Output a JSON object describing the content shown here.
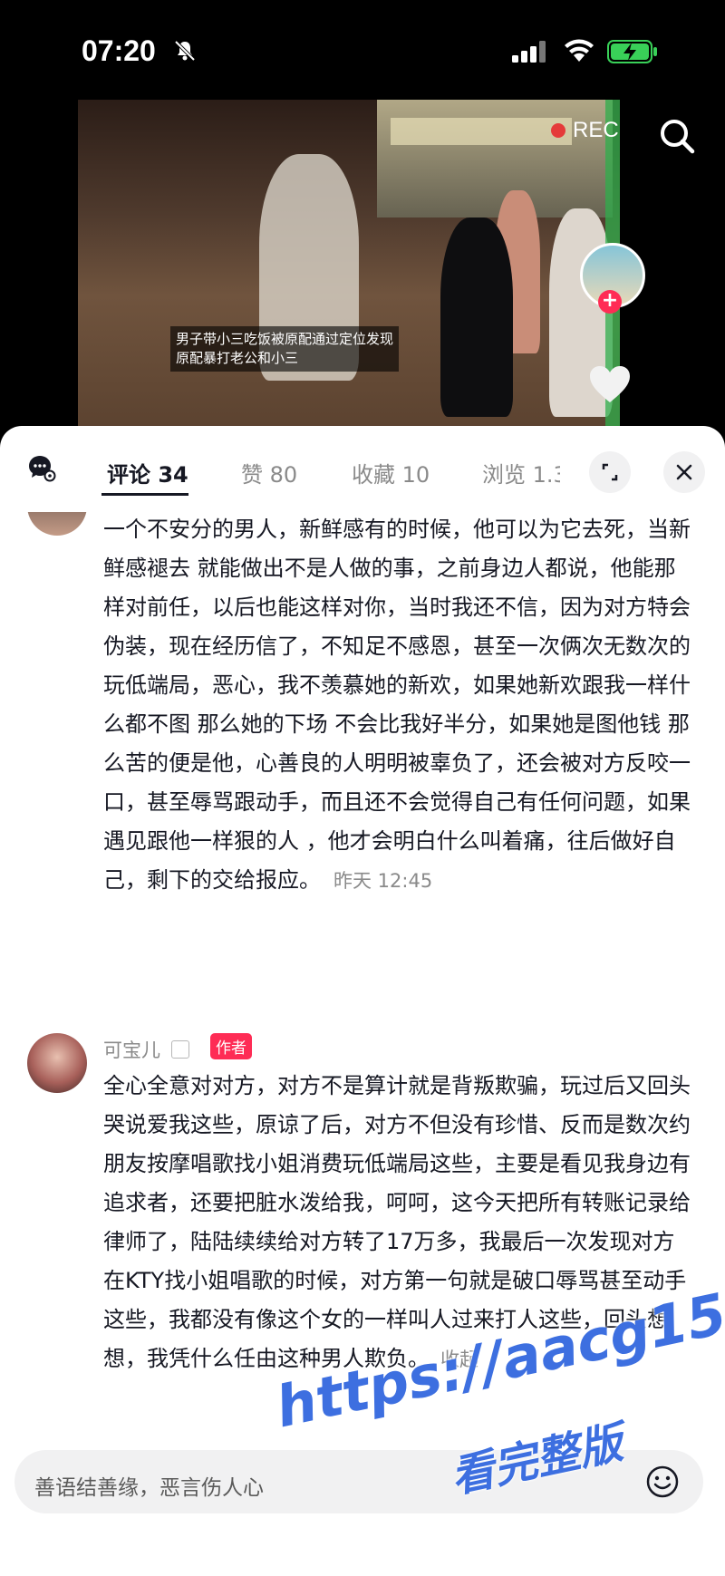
{
  "status_bar": {
    "time": "07:20"
  },
  "video": {
    "caption": "男子带小三吃饭被原配通过定位发现\n原配暴打老公和小三",
    "rec_label": "REC"
  },
  "tabs": [
    {
      "label": "评论 34",
      "active": true
    },
    {
      "label": "赞 80",
      "active": false
    },
    {
      "label": "收藏 10",
      "active": false
    },
    {
      "label": "浏览 1.3",
      "active": false
    }
  ],
  "comments": [
    {
      "text": "一个不安分的男人，新鲜感有的时候，他可以为它去死，当新鲜感褪去 就能做出不是人做的事，之前身边人都说，他能那样对前任，以后也能这样对你，当时我还不信，因为对方特会伪装，现在经历信了，不知足不感恩，甚至一次俩次无数次的玩低端局，恶心，我不羡慕她的新欢，如果她新欢跟我一样什么都不图 那么她的下场 不会比我好半分，如果她是图他钱 那么苦的便是他，心善良的人明明被辜负了，还会被对方反咬一口，甚至辱骂跟动手，而且还不会觉得自己有任何问题，如果遇见跟他一样狠的人 ，他才会明白什么叫着痛，往后做好自己，剩下的交给报应。",
      "time": "昨天 12:45"
    },
    {
      "username": "可宝儿",
      "badge": "作者",
      "text": "全心全意对对方，对方不是算计就是背叛欺骗，玩过后又回头哭说爱我这些，原谅了后，对方不但没有珍惜、反而是数次约朋友按摩唱歌找小姐消费玩低端局这些，主要是看见我身边有追求者，还要把脏水泼给我，呵呵，这今天把所有转账记录给律师了，陆陆续续给对方转了17万多，我最后一次发现对方在KTY找小姐唱歌的时候，对方第一句就是破口辱骂甚至动手这些，我都没有像这个女的一样叫人过来打人这些，回头想想，我凭什么任由这种男人欺负。",
      "collapse": "收起"
    }
  ],
  "input": {
    "placeholder": "善语结善缘，恶言伤人心"
  },
  "watermark": {
    "line1": "https://aacg15.com",
    "line2": "看完整版"
  },
  "colors": {
    "accent": "#fe2c55",
    "watermark": "#3d6fe0"
  }
}
